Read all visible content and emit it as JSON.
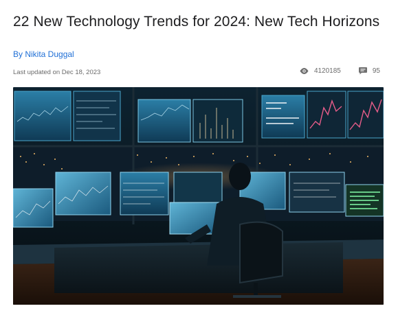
{
  "article": {
    "title": "22 New Technology Trends for 2024: New Tech Horizons",
    "author": "By Nikita Duggal",
    "updated": "Last updated on Dec 18, 2023"
  },
  "stats": {
    "views": "4120185",
    "views_icon": "eye-icon",
    "comments": "95",
    "comments_icon": "comment-icon"
  },
  "hero": {
    "icon": "hero-illustration",
    "palette": {
      "accent": "#1f6fd6",
      "screen": "#2a8fb8",
      "night": "#0a1a24",
      "chart": "#e85d8a"
    }
  }
}
